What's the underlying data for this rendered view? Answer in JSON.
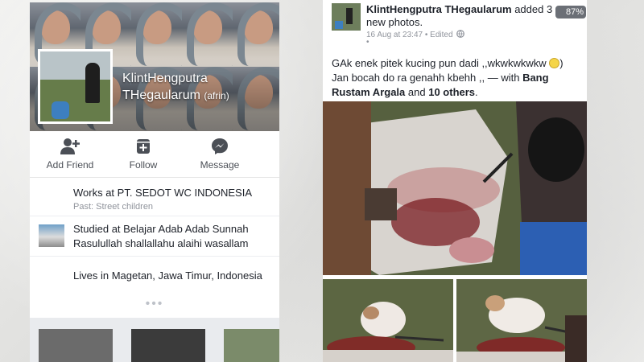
{
  "profile": {
    "name_line1": "KlintHengputra",
    "name_line2": "THegaularum",
    "alt_name": "(afrin)"
  },
  "actions": {
    "add_friend": "Add Friend",
    "follow": "Follow",
    "message": "Message"
  },
  "about": {
    "work": "Works at PT. SEDOT WC INDONESIA",
    "work_past": "Past: Street children",
    "study_line1": "Studied at Belajar Adab Adab Sunnah",
    "study_line2": "Rasulullah shallallahu alaihi wasallam",
    "lives": "Lives in Magetan, Jawa Timur, Indonesia"
  },
  "post": {
    "author": "KlintHengputra THegaularum",
    "action_line1": "added 3",
    "action_line2": "new photos.",
    "timestamp": "16 Aug at 23:47",
    "edited": "Edited",
    "text_line1": "GAk enek pitek kucing pun dadi ,,wkwkwkwkw",
    "text_line2_a": "Jan bocah do ra genahh kbehh ,, — with",
    "tag_name1": "Bang",
    "tag_name2": "Rustam Argala",
    "and_word": "and",
    "others": "10 others",
    "period": "."
  },
  "status": {
    "battery": "87%"
  },
  "icons": {
    "add_friend": "add-friend-icon",
    "follow": "follow-icon",
    "message": "messenger-icon",
    "privacy": "globe-icon"
  },
  "colors": {
    "facebook_gray": "#4b4f56",
    "meta_gray": "#90949c"
  }
}
